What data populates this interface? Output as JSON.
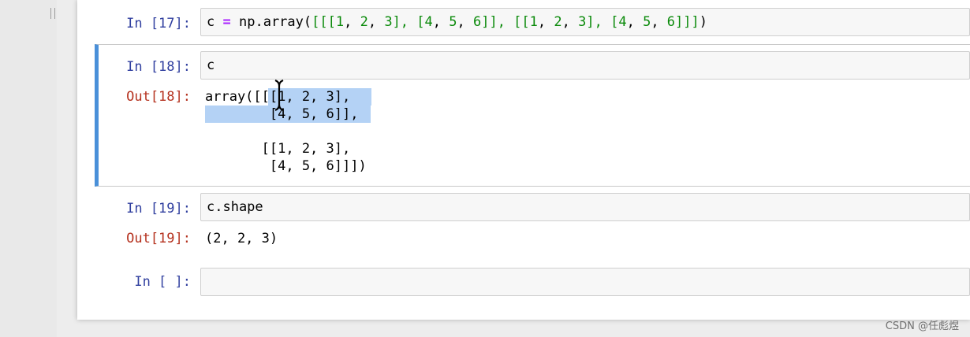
{
  "cells": [
    {
      "in_prompt": "In [17]:",
      "source_parts": {
        "var": "c",
        "op": "=",
        "fn": "np.array(",
        "b1": "[[[",
        "n1": "1",
        "s1": ", ",
        "n2": "2",
        "s2": ", ",
        "n3": "3",
        "b2": "], [",
        "n4": "4",
        "s3": ", ",
        "n5": "5",
        "s4": ", ",
        "n6": "6",
        "b3": "]], [[",
        "n7": "1",
        "s5": ", ",
        "n8": "2",
        "s6": ", ",
        "n9": "3",
        "b4": "], [",
        "n10": "4",
        "s7": ", ",
        "n11": "5",
        "s8": ", ",
        "n12": "6",
        "b5": "]]]",
        "close": ")"
      }
    },
    {
      "in_prompt": "In [18]:",
      "source": "c",
      "out_prompt": "Out[18]:",
      "output_lines": [
        "array([[[1, 2, 3],",
        "        [4, 5, 6]],",
        "",
        "       [[1, 2, 3],",
        "        [4, 5, 6]]])"
      ]
    },
    {
      "in_prompt": "In [19]:",
      "source": "c.shape",
      "out_prompt": "Out[19]:",
      "output_lines": [
        "(2, 2, 3)"
      ]
    },
    {
      "in_prompt": "In [ ]:",
      "source": ""
    }
  ],
  "watermark": "CSDN @任彪煜",
  "colors": {
    "selected_cell_bar": "#4a90d9",
    "in_prompt": "#303f9f",
    "out_prompt": "#b5321f",
    "selection_highlight": "#b4d2f5"
  },
  "icons": {
    "text_cursor": "i-beam-cursor-icon",
    "drag_handle": "grip-icon"
  }
}
